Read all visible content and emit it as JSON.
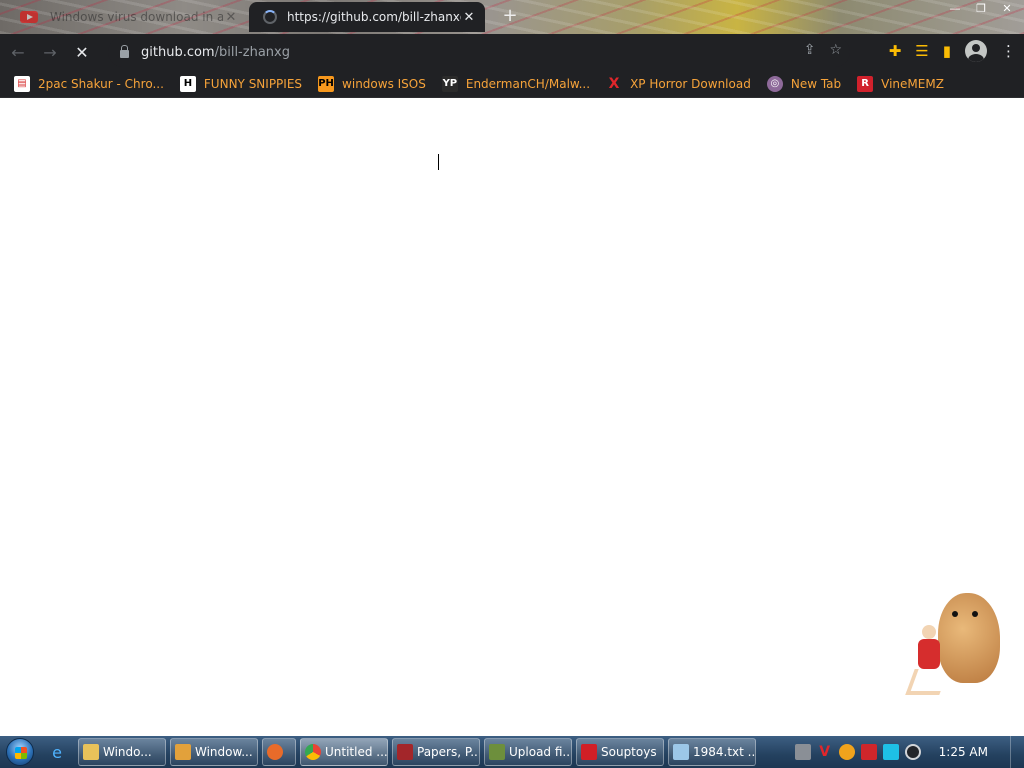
{
  "tabs": [
    {
      "title": "Windows virus download in any G...",
      "favicon": "youtube-icon",
      "state": "inactive"
    },
    {
      "title": "https://github.com/bill-zhanxg",
      "favicon": "loading-spinner",
      "state": "active"
    }
  ],
  "toolbar": {
    "url_host": "github.com",
    "url_path": "/bill-zhanxg"
  },
  "bookmarks": [
    {
      "label": "2pac Shakur - Chro...",
      "icon": "calendar-icon",
      "color": "#ffffff"
    },
    {
      "label": "FUNNY SNIPPIES",
      "icon": "h-letter-icon",
      "color": "#2b2b2b"
    },
    {
      "label": "windows ISOS",
      "icon": "ph-icon",
      "color": "#f7981d"
    },
    {
      "label": "EndermanCH/Malw...",
      "icon": "yp-icon",
      "color": "#2b2b2b"
    },
    {
      "label": "XP Horror Download",
      "icon": "x-icon",
      "color": "#202124"
    },
    {
      "label": "New Tab",
      "icon": "globe-icon",
      "color": "#8e6a9a"
    },
    {
      "label": "VineMEMZ",
      "icon": "r-icon",
      "color": "#d1212c"
    }
  ],
  "taskbar": {
    "tasks": [
      {
        "label": "Windo...",
        "icon": "explorer-icon",
        "color": "#e8c25a"
      },
      {
        "label": "Window...",
        "icon": "media-icon",
        "color": "#e2a13b"
      },
      {
        "label": "",
        "icon": "app-icon",
        "color": "#e86b2a"
      },
      {
        "label": "Untitled ...",
        "icon": "chrome-icon",
        "color": "#34a853"
      },
      {
        "label": "Papers, P...",
        "icon": "papers-icon",
        "color": "#a3262a"
      },
      {
        "label": "Upload fi...",
        "icon": "upload-icon",
        "color": "#6d8f3c"
      },
      {
        "label": "Souptoys",
        "icon": "souptoys-icon",
        "color": "#d11f26"
      },
      {
        "label": "1984.txt ...",
        "icon": "notepad-icon",
        "color": "#9cc7e8"
      }
    ],
    "tray_icons": [
      "network-icon",
      "v-icon",
      "search-icon",
      "flag-icon",
      "monitor-icon",
      "clock-app-icon"
    ],
    "clock": "1:25 AM"
  }
}
